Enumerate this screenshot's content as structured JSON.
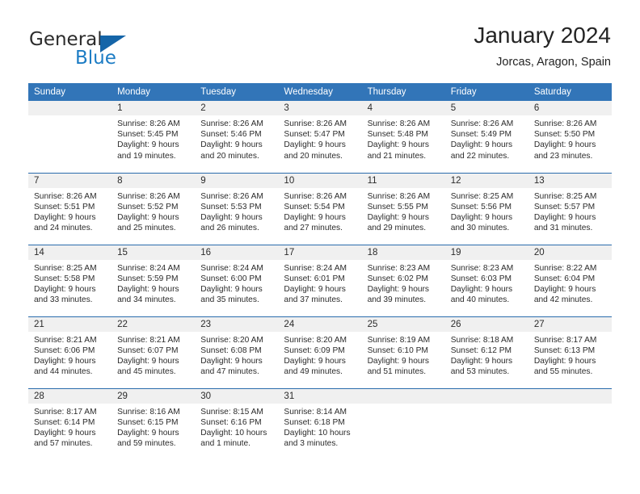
{
  "brand": {
    "name_part1": "General",
    "name_part2": "Blue",
    "triangle_color": "#1565a8",
    "blue_color": "#1c7cc4"
  },
  "header": {
    "title": "January 2024",
    "location": "Jorcas, Aragon, Spain"
  },
  "theme": {
    "header_row_bg": "#3275b8",
    "row_divider": "#2b6cad",
    "daynum_bg": "#f0f0f0",
    "page_bg": "#ffffff"
  },
  "calendar": {
    "weekday_headers": [
      "Sunday",
      "Monday",
      "Tuesday",
      "Wednesday",
      "Thursday",
      "Friday",
      "Saturday"
    ],
    "weeks": [
      [
        {
          "day": "",
          "info": ""
        },
        {
          "day": "1",
          "info": "Sunrise: 8:26 AM\nSunset: 5:45 PM\nDaylight: 9 hours\nand 19 minutes."
        },
        {
          "day": "2",
          "info": "Sunrise: 8:26 AM\nSunset: 5:46 PM\nDaylight: 9 hours\nand 20 minutes."
        },
        {
          "day": "3",
          "info": "Sunrise: 8:26 AM\nSunset: 5:47 PM\nDaylight: 9 hours\nand 20 minutes."
        },
        {
          "day": "4",
          "info": "Sunrise: 8:26 AM\nSunset: 5:48 PM\nDaylight: 9 hours\nand 21 minutes."
        },
        {
          "day": "5",
          "info": "Sunrise: 8:26 AM\nSunset: 5:49 PM\nDaylight: 9 hours\nand 22 minutes."
        },
        {
          "day": "6",
          "info": "Sunrise: 8:26 AM\nSunset: 5:50 PM\nDaylight: 9 hours\nand 23 minutes."
        }
      ],
      [
        {
          "day": "7",
          "info": "Sunrise: 8:26 AM\nSunset: 5:51 PM\nDaylight: 9 hours\nand 24 minutes."
        },
        {
          "day": "8",
          "info": "Sunrise: 8:26 AM\nSunset: 5:52 PM\nDaylight: 9 hours\nand 25 minutes."
        },
        {
          "day": "9",
          "info": "Sunrise: 8:26 AM\nSunset: 5:53 PM\nDaylight: 9 hours\nand 26 minutes."
        },
        {
          "day": "10",
          "info": "Sunrise: 8:26 AM\nSunset: 5:54 PM\nDaylight: 9 hours\nand 27 minutes."
        },
        {
          "day": "11",
          "info": "Sunrise: 8:26 AM\nSunset: 5:55 PM\nDaylight: 9 hours\nand 29 minutes."
        },
        {
          "day": "12",
          "info": "Sunrise: 8:25 AM\nSunset: 5:56 PM\nDaylight: 9 hours\nand 30 minutes."
        },
        {
          "day": "13",
          "info": "Sunrise: 8:25 AM\nSunset: 5:57 PM\nDaylight: 9 hours\nand 31 minutes."
        }
      ],
      [
        {
          "day": "14",
          "info": "Sunrise: 8:25 AM\nSunset: 5:58 PM\nDaylight: 9 hours\nand 33 minutes."
        },
        {
          "day": "15",
          "info": "Sunrise: 8:24 AM\nSunset: 5:59 PM\nDaylight: 9 hours\nand 34 minutes."
        },
        {
          "day": "16",
          "info": "Sunrise: 8:24 AM\nSunset: 6:00 PM\nDaylight: 9 hours\nand 35 minutes."
        },
        {
          "day": "17",
          "info": "Sunrise: 8:24 AM\nSunset: 6:01 PM\nDaylight: 9 hours\nand 37 minutes."
        },
        {
          "day": "18",
          "info": "Sunrise: 8:23 AM\nSunset: 6:02 PM\nDaylight: 9 hours\nand 39 minutes."
        },
        {
          "day": "19",
          "info": "Sunrise: 8:23 AM\nSunset: 6:03 PM\nDaylight: 9 hours\nand 40 minutes."
        },
        {
          "day": "20",
          "info": "Sunrise: 8:22 AM\nSunset: 6:04 PM\nDaylight: 9 hours\nand 42 minutes."
        }
      ],
      [
        {
          "day": "21",
          "info": "Sunrise: 8:21 AM\nSunset: 6:06 PM\nDaylight: 9 hours\nand 44 minutes."
        },
        {
          "day": "22",
          "info": "Sunrise: 8:21 AM\nSunset: 6:07 PM\nDaylight: 9 hours\nand 45 minutes."
        },
        {
          "day": "23",
          "info": "Sunrise: 8:20 AM\nSunset: 6:08 PM\nDaylight: 9 hours\nand 47 minutes."
        },
        {
          "day": "24",
          "info": "Sunrise: 8:20 AM\nSunset: 6:09 PM\nDaylight: 9 hours\nand 49 minutes."
        },
        {
          "day": "25",
          "info": "Sunrise: 8:19 AM\nSunset: 6:10 PM\nDaylight: 9 hours\nand 51 minutes."
        },
        {
          "day": "26",
          "info": "Sunrise: 8:18 AM\nSunset: 6:12 PM\nDaylight: 9 hours\nand 53 minutes."
        },
        {
          "day": "27",
          "info": "Sunrise: 8:17 AM\nSunset: 6:13 PM\nDaylight: 9 hours\nand 55 minutes."
        }
      ],
      [
        {
          "day": "28",
          "info": "Sunrise: 8:17 AM\nSunset: 6:14 PM\nDaylight: 9 hours\nand 57 minutes."
        },
        {
          "day": "29",
          "info": "Sunrise: 8:16 AM\nSunset: 6:15 PM\nDaylight: 9 hours\nand 59 minutes."
        },
        {
          "day": "30",
          "info": "Sunrise: 8:15 AM\nSunset: 6:16 PM\nDaylight: 10 hours\nand 1 minute."
        },
        {
          "day": "31",
          "info": "Sunrise: 8:14 AM\nSunset: 6:18 PM\nDaylight: 10 hours\nand 3 minutes."
        },
        {
          "day": "",
          "info": ""
        },
        {
          "day": "",
          "info": ""
        },
        {
          "day": "",
          "info": ""
        }
      ]
    ]
  }
}
